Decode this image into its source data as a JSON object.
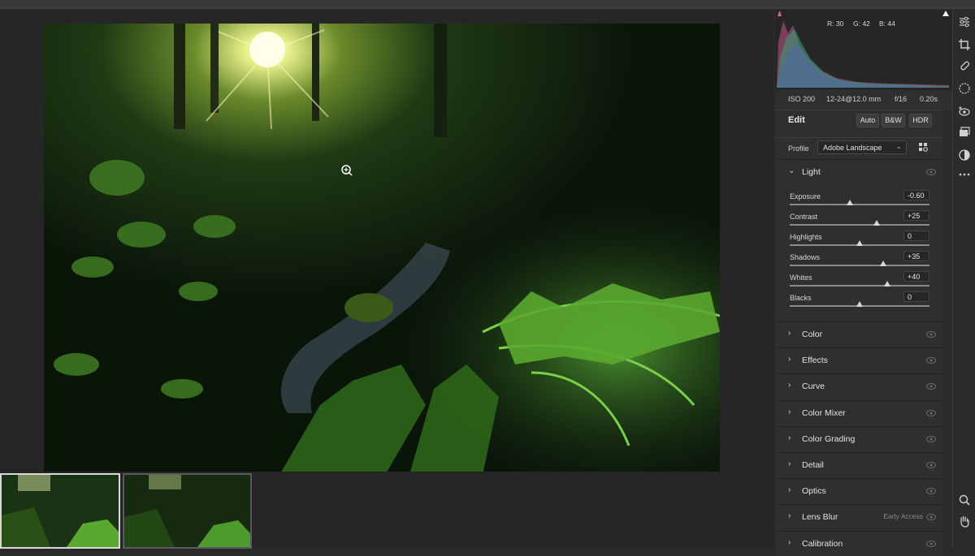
{
  "histogram": {
    "r_label": "R: 30",
    "g_label": "G: 42",
    "b_label": "B: 44"
  },
  "exif": {
    "iso": "ISO 200",
    "lens": "12-24@12.0 mm",
    "aperture": "f/16",
    "shutter": "0.20s"
  },
  "edit": {
    "title": "Edit",
    "auto": "Auto",
    "bw": "B&W",
    "hdr": "HDR"
  },
  "profile": {
    "label": "Profile",
    "value": "Adobe Landscape"
  },
  "light": {
    "title": "Light",
    "sliders": [
      {
        "label": "Exposure",
        "value": "-0.60",
        "position": 0.43
      },
      {
        "label": "Contrast",
        "value": "+25",
        "position": 0.62
      },
      {
        "label": "Highlights",
        "value": "0",
        "position": 0.5
      },
      {
        "label": "Shadows",
        "value": "+35",
        "position": 0.67
      },
      {
        "label": "Whites",
        "value": "+40",
        "position": 0.7
      },
      {
        "label": "Blacks",
        "value": "0",
        "position": 0.5
      }
    ]
  },
  "sections": [
    {
      "name": "Color"
    },
    {
      "name": "Effects"
    },
    {
      "name": "Curve"
    },
    {
      "name": "Color Mixer"
    },
    {
      "name": "Color Grading"
    },
    {
      "name": "Detail"
    },
    {
      "name": "Optics"
    },
    {
      "name": "Lens Blur",
      "badge": "Early Access"
    },
    {
      "name": "Calibration"
    }
  ],
  "icons": [
    "edit-sliders-icon",
    "crop-icon",
    "healing-brush-icon",
    "masking-icon",
    "red-eye-icon",
    "layers-icon",
    "presets-icon",
    "more-icon",
    "zoom-icon",
    "hand-icon"
  ]
}
